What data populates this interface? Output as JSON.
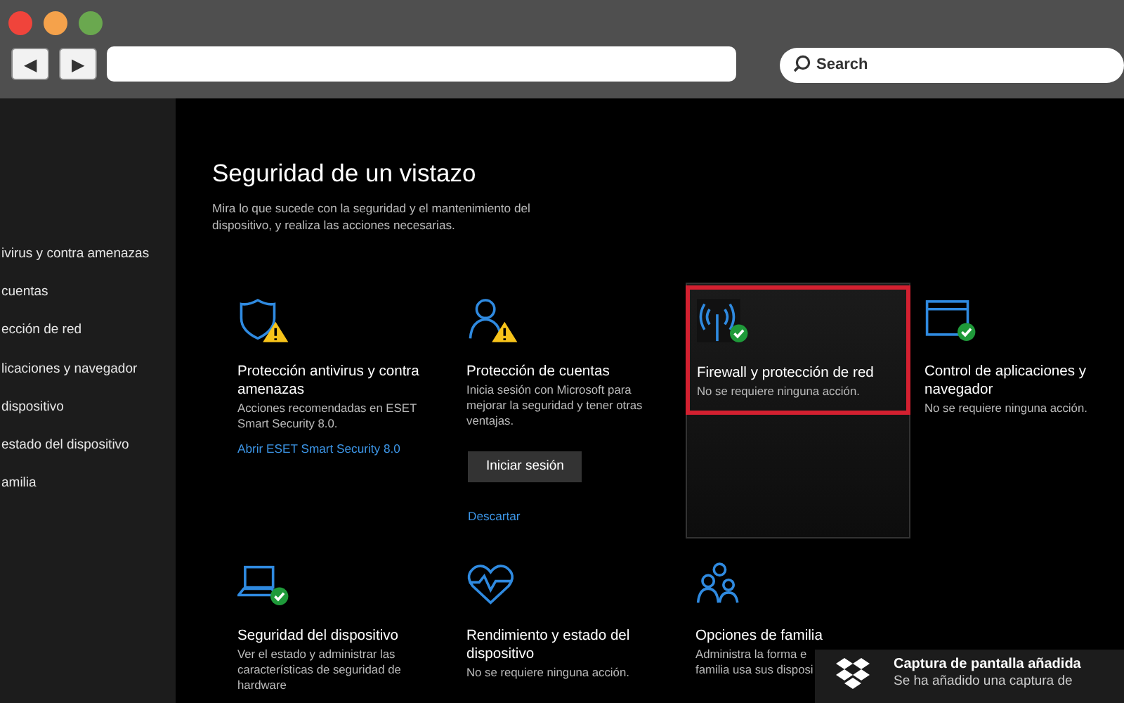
{
  "toolbar": {
    "back": "◀",
    "forward": "▶",
    "search": {
      "placeholder": "Search"
    }
  },
  "sidebar": {
    "items": [
      {
        "label": "ivirus y contra amenazas"
      },
      {
        "label": "cuentas"
      },
      {
        "label": "ección de red"
      },
      {
        "label": "licaciones y navegador"
      },
      {
        "label": "dispositivo"
      },
      {
        "label": "estado del dispositivo"
      },
      {
        "label": "amilia"
      }
    ]
  },
  "heading": "Seguridad de un vistazo",
  "intro": "Mira lo que sucede con la seguridad y el mantenimiento del dispositivo, y realiza las acciones necesarias.",
  "cards": [
    {
      "kind": "shield",
      "warning": true,
      "ok": false,
      "selected": false,
      "title": "Protección antivirus y contra amenazas",
      "description": [
        "Acciones recomendadas en ESET Smart Security 8.0."
      ],
      "link": "Abrir ESET Smart Security 8.0"
    },
    {
      "kind": "person",
      "warning": true,
      "ok": false,
      "selected": false,
      "title": "Protección de cuentas",
      "description": [
        "Inicia sesión con Microsoft para mejorar la seguridad y tener otras ventajas."
      ],
      "button": "Iniciar sesión",
      "link_below": "Descartar"
    },
    {
      "kind": "antenna",
      "warning": false,
      "ok": true,
      "selected": true,
      "title": "Firewall y protección de red",
      "description": [
        "No se requiere ninguna acción."
      ]
    },
    {
      "kind": "window",
      "warning": false,
      "ok": true,
      "selected": false,
      "title": "Control de aplicaciones y navegador",
      "description": [
        "No se requiere ninguna acción."
      ]
    },
    {
      "kind": "laptop",
      "warning": false,
      "ok": true,
      "selected": false,
      "title": "Seguridad del dispositivo",
      "description": [
        "Ver el estado y administrar las características de seguridad de hardware"
      ]
    },
    {
      "kind": "heart",
      "warning": false,
      "ok": false,
      "selected": false,
      "title": "Rendimiento y estado del dispositivo",
      "description": [
        "No se requiere ninguna acción."
      ]
    },
    {
      "kind": "family",
      "warning": false,
      "ok": false,
      "selected": false,
      "title": "Opciones de familia",
      "description": [
        "Administra la forma e",
        "familia usa sus disposi"
      ]
    }
  ],
  "toast": {
    "title": "Captura de pantalla añadida",
    "body": "Se ha añadido una captura de"
  }
}
